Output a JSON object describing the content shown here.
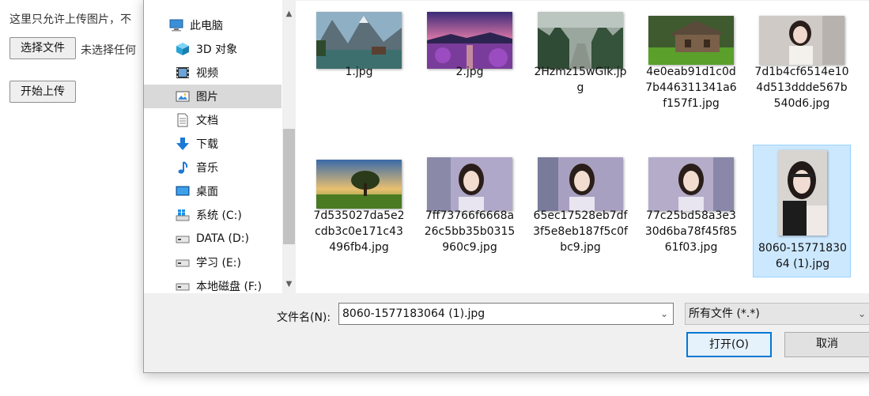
{
  "page": {
    "hint": "这里只允许上传图片，不",
    "choose_button": "选择文件",
    "no_file_text": "未选择任何",
    "upload_button": "开始上传"
  },
  "dialog": {
    "nav_items": [
      {
        "label": "此电脑",
        "icon": "computer-icon"
      },
      {
        "label": "3D 对象",
        "icon": "cube-3d-icon"
      },
      {
        "label": "视频",
        "icon": "video-icon"
      },
      {
        "label": "图片",
        "icon": "picture-icon",
        "selected": true
      },
      {
        "label": "文档",
        "icon": "document-icon"
      },
      {
        "label": "下载",
        "icon": "download-icon"
      },
      {
        "label": "音乐",
        "icon": "music-icon"
      },
      {
        "label": "桌面",
        "icon": "desktop-icon"
      },
      {
        "label": "系统 (C:)",
        "icon": "windows-drive-icon"
      },
      {
        "label": "DATA (D:)",
        "icon": "drive-icon"
      },
      {
        "label": "学习 (E:)",
        "icon": "drive-icon"
      },
      {
        "label": "本地磁盘 (F:)",
        "icon": "drive-icon"
      }
    ],
    "files": [
      {
        "name": "1.jpg",
        "thumb": "lake-mountain-thumbnail"
      },
      {
        "name": "2.jpg",
        "thumb": "purple-sunset-thumbnail"
      },
      {
        "name": "2Hzmz15wGik.jpg",
        "thumb": "misty-forest-thumbnail"
      },
      {
        "name": "4e0eab91d1c0d7b446311341a6f157f1.jpg",
        "thumb": "wooden-cabin-thumbnail"
      },
      {
        "name": "7d1b4cf6514e104d513ddde567b540d6.jpg",
        "thumb": "portrait-girl-thumbnail"
      },
      {
        "name": "7d535027da5e2cdb3c0e171c43496fb4.jpg",
        "thumb": "tree-field-thumbnail"
      },
      {
        "name": "7ff73766f6668a26c5bb35b0315960c9.jpg",
        "thumb": "portrait-girl-thumbnail"
      },
      {
        "name": "65ec17528eb7df3f5e8eb187f5c0fbc9.jpg",
        "thumb": "portrait-girl-thumbnail"
      },
      {
        "name": "77c25bd58a3e330d6ba78f45f8561f03.jpg",
        "thumb": "portrait-girl-thumbnail"
      },
      {
        "name": "8060-1577183064 (1).jpg",
        "thumb": "portrait-girl-vertical-thumbnail",
        "selected": true
      }
    ],
    "filename_label": "文件名(N):",
    "filename_value": "8060-1577183064 (1).jpg",
    "filter_value": "所有文件 (*.*)",
    "open_button": "打开(O)",
    "cancel_button": "取消"
  },
  "colors": {
    "selection": "#cce8ff",
    "nav_selected": "#d9d9d9",
    "default_button_border": "#0078d7"
  }
}
